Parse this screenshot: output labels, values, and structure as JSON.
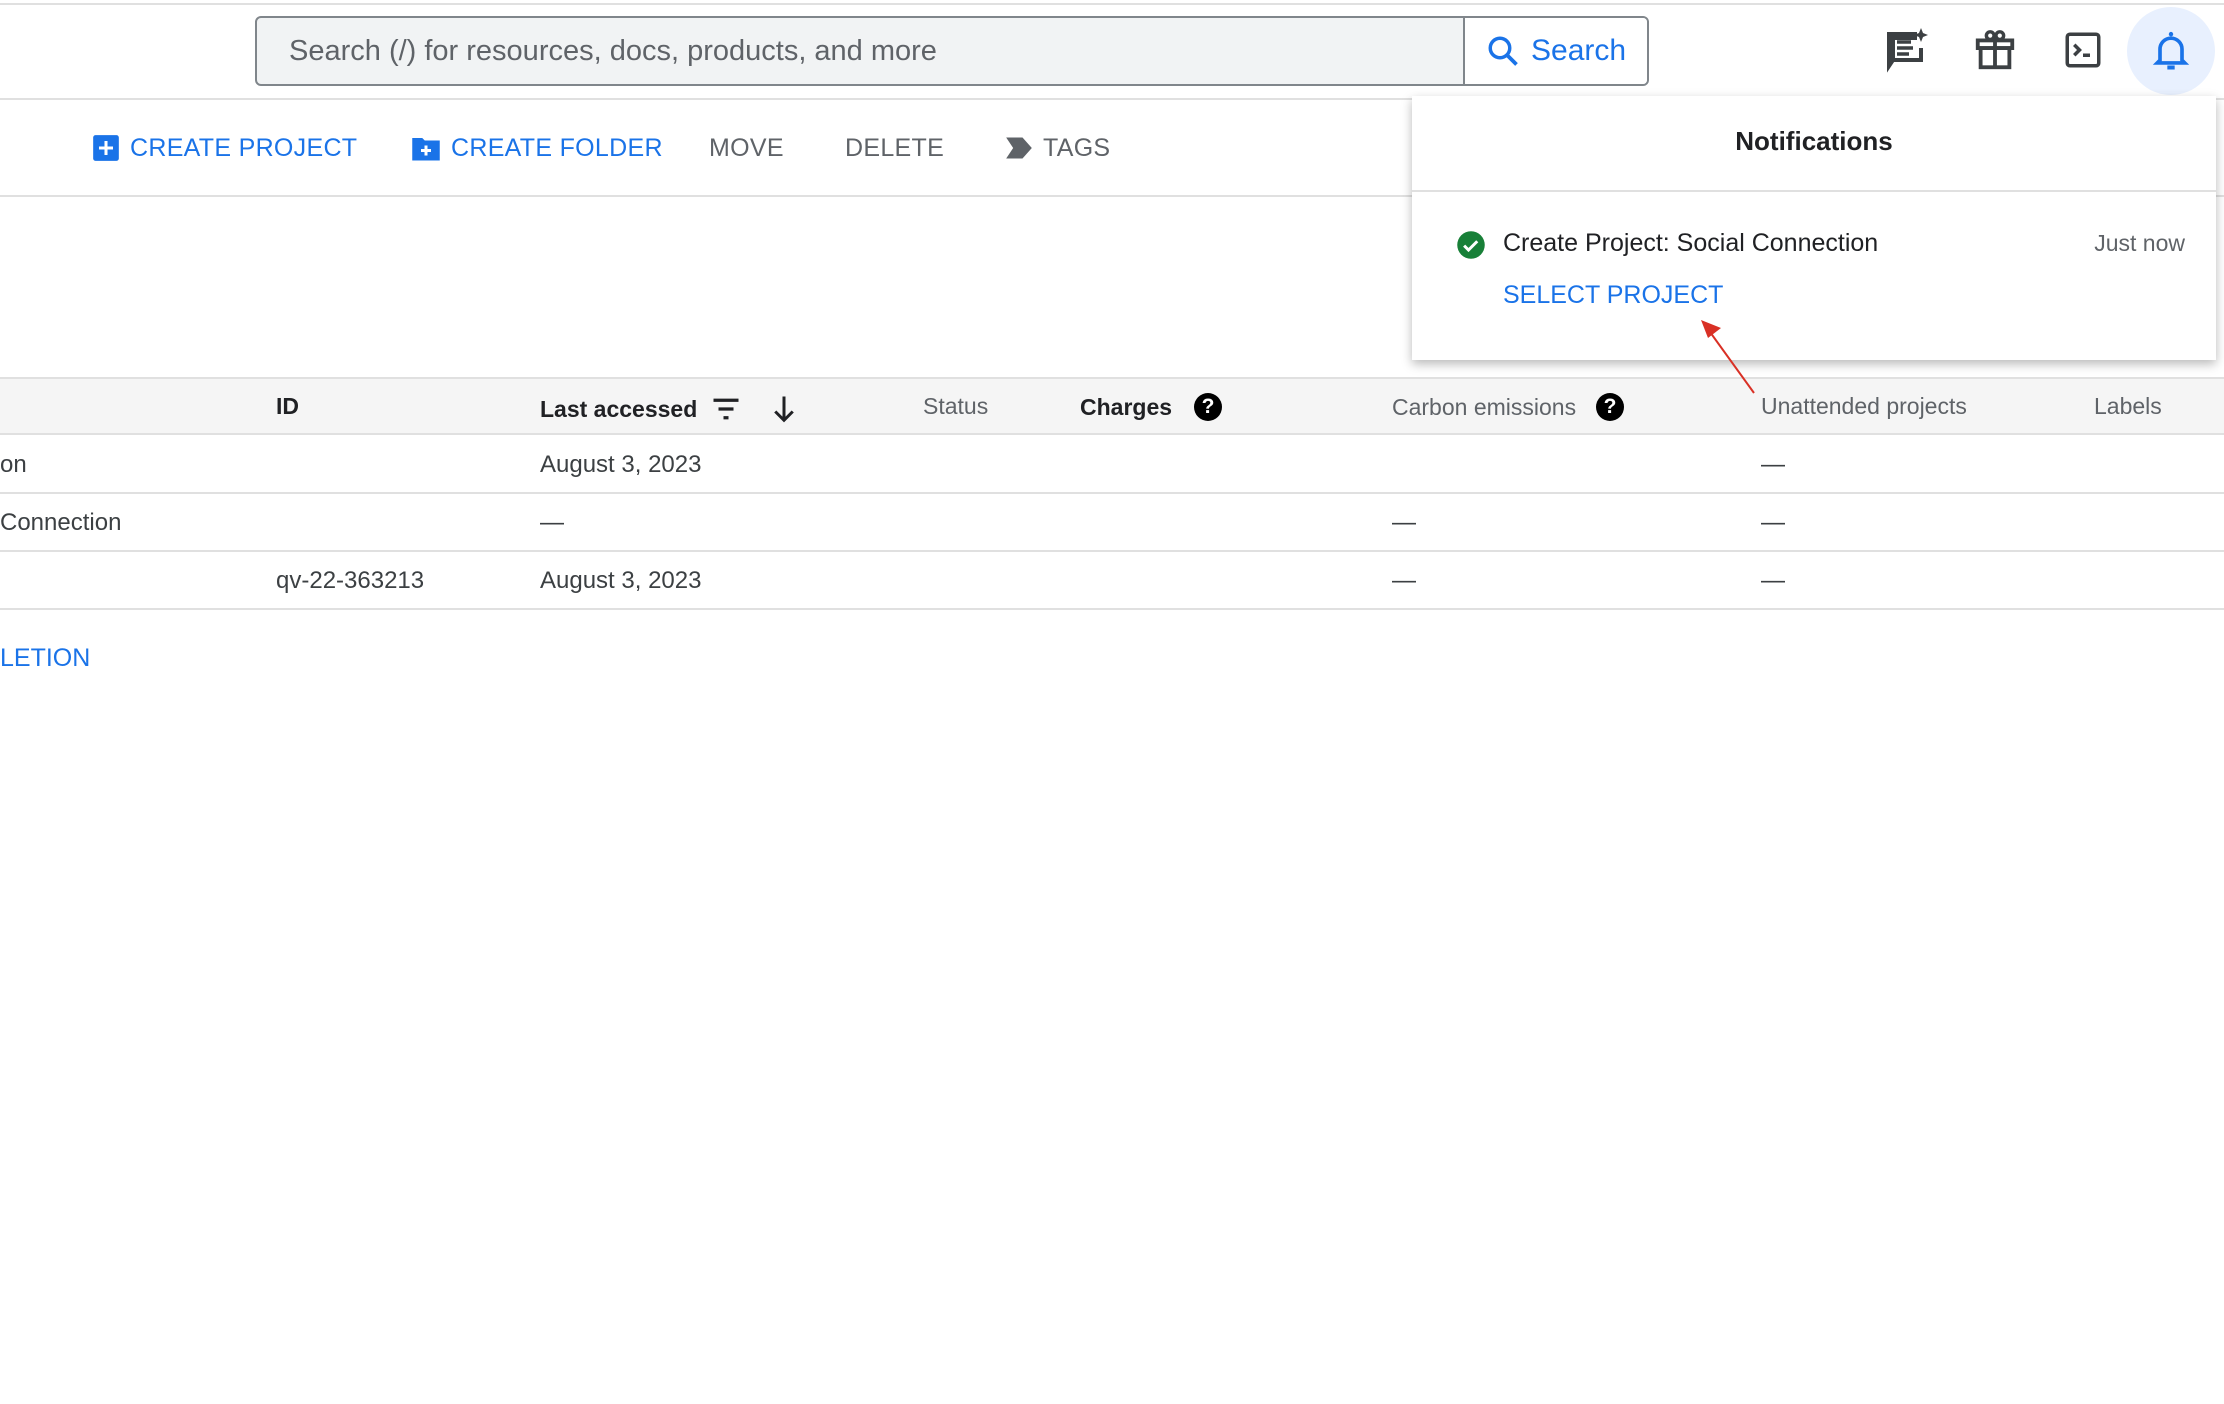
{
  "header": {
    "search_placeholder": "Search (/) for resources, docs, products, and more",
    "search_button": "Search",
    "icons": [
      "feedback-sparkle-icon",
      "gift-icon",
      "cloud-shell-terminal-icon",
      "bell-icon"
    ]
  },
  "toolbar": {
    "create_project": "CREATE PROJECT",
    "create_folder": "CREATE FOLDER",
    "move": "MOVE",
    "delete": "DELETE",
    "tags": "TAGS"
  },
  "table": {
    "columns": {
      "id": "ID",
      "last_accessed": "Last accessed",
      "status": "Status",
      "charges": "Charges",
      "carbon": "Carbon emissions",
      "unattended": "Unattended projects",
      "labels": "Labels"
    },
    "rows": [
      {
        "name": "on",
        "id": "",
        "last_accessed": "August 3, 2023",
        "carbon": "",
        "unattended": "—"
      },
      {
        "name": "Connection",
        "id": "",
        "last_accessed": "—",
        "carbon": "—",
        "unattended": "—"
      },
      {
        "name": "",
        "id": "qv-22-363213",
        "last_accessed": "August 3, 2023",
        "carbon": "—",
        "unattended": "—"
      }
    ],
    "link": "LETION"
  },
  "notifications": {
    "title": "Notifications",
    "items": [
      {
        "text": "Create Project: Social Connection",
        "time": "Just now",
        "action": "SELECT PROJECT",
        "status": "success"
      }
    ]
  },
  "colors": {
    "accent": "#1a73e8",
    "success": "#188038",
    "annotation_arrow": "#d93025"
  }
}
